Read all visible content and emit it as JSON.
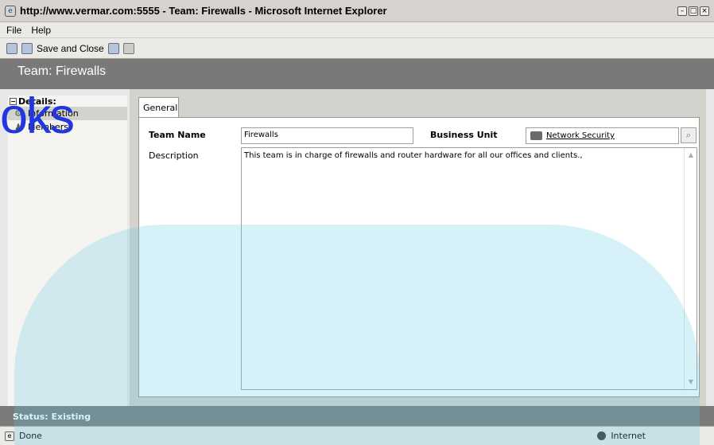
{
  "browser": {
    "title": "http://www.vermar.com:5555 - Team: Firewalls - Microsoft Internet Explorer",
    "menu": [
      "File",
      "Help"
    ],
    "status_left": "Done",
    "status_zone": "Internet"
  },
  "toolbar": {
    "save_close_label": "Save and Close"
  },
  "form": {
    "header_title": "Team: Firewalls",
    "watermark_text": "oks",
    "sidebar": {
      "section": "Details:",
      "items": [
        "Information",
        "Members"
      ]
    },
    "tab": "General",
    "team_name_label": "Team Name",
    "team_name_value": "Firewalls",
    "business_unit_label": "Business Unit",
    "business_unit_value": "Network Security",
    "description_label": "Description",
    "description_value": "This team is in charge of firewalls and router hardware for all our offices and clients.,",
    "status": "Status: Existing"
  },
  "colors": {
    "watermark": "#1f36e0",
    "header_bg": "#797979",
    "status_bg": "#7b7b7b"
  }
}
